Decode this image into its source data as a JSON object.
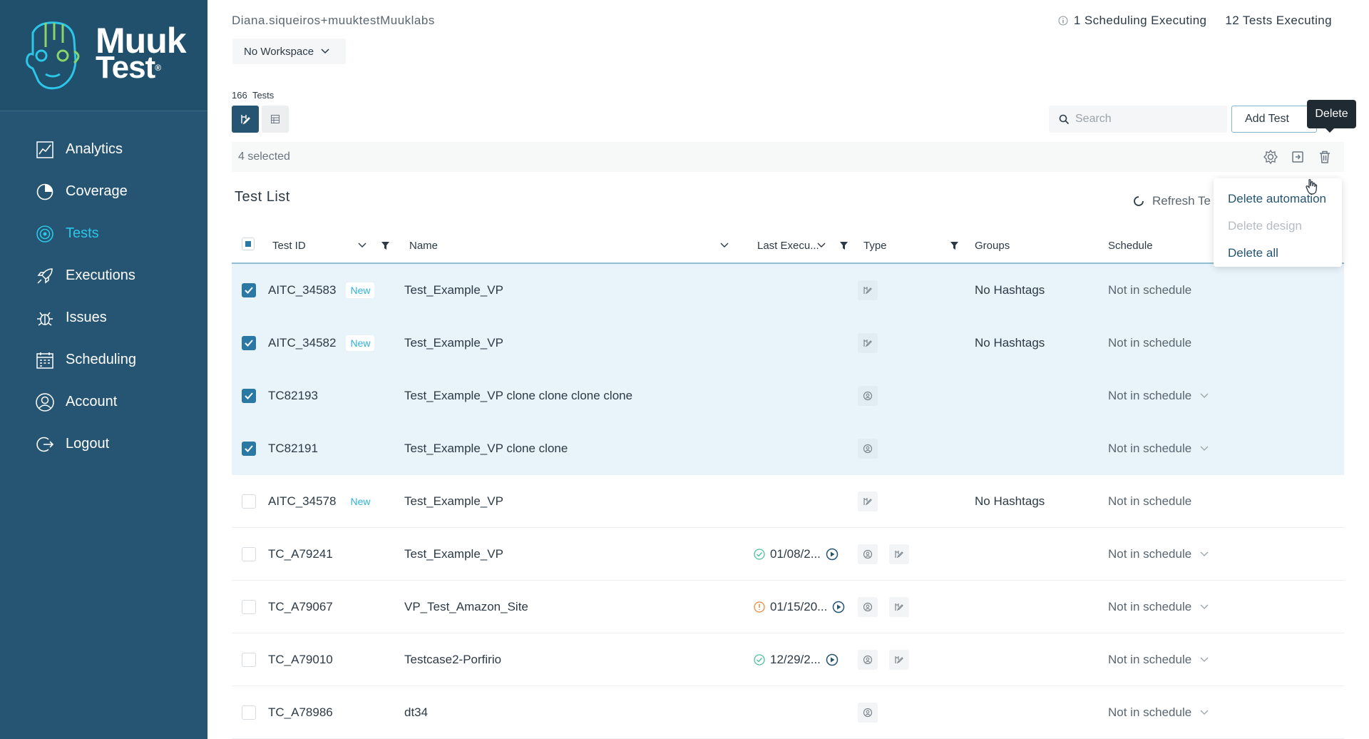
{
  "brand": {
    "line1": "Muuk",
    "line2": "Test",
    "reg": "®"
  },
  "sidebar": {
    "items": [
      {
        "label": "Analytics",
        "icon": "analytics-icon",
        "active": false
      },
      {
        "label": "Coverage",
        "icon": "coverage-icon",
        "active": false
      },
      {
        "label": "Tests",
        "icon": "tests-icon",
        "active": true
      },
      {
        "label": "Executions",
        "icon": "rocket-icon",
        "active": false
      },
      {
        "label": "Issues",
        "icon": "bug-icon",
        "active": false
      },
      {
        "label": "Scheduling",
        "icon": "calendar-icon",
        "active": false
      },
      {
        "label": "Account",
        "icon": "user-icon",
        "active": false
      },
      {
        "label": "Logout",
        "icon": "logout-icon",
        "active": false
      }
    ]
  },
  "header": {
    "user": "Diana.siqueiros+muuktestMuuklabs",
    "workspace": "No Workspace",
    "scheduling_executing": "1 Scheduling Executing",
    "tests_executing": "12 Tests Executing"
  },
  "toolbar": {
    "count": "166",
    "count_label": "Tests",
    "search_placeholder": "Search",
    "add_test": "Add Test",
    "tooltip": "Delete"
  },
  "selection": {
    "text": "4 selected"
  },
  "list": {
    "title": "Test List",
    "refresh": "Refresh Te",
    "columns": {
      "test_id": "Test ID",
      "name": "Name",
      "last_exec": "Last Execu...",
      "type": "Type",
      "groups": "Groups",
      "schedule": "Schedule"
    },
    "rows": [
      {
        "checked": true,
        "id": "AITC_34583",
        "badge": "New",
        "name": "Test_Example_VP",
        "last": "",
        "status": "",
        "types": [
          "design"
        ],
        "groups": "No Hashtags",
        "schedule": "Not in schedule",
        "dropdown": false
      },
      {
        "checked": true,
        "id": "AITC_34582",
        "badge": "New",
        "name": "Test_Example_VP",
        "last": "",
        "status": "",
        "types": [
          "design"
        ],
        "groups": "No Hashtags",
        "schedule": "Not in schedule",
        "dropdown": false
      },
      {
        "checked": true,
        "id": "TC82193",
        "badge": "",
        "name": "Test_Example_VP clone clone clone clone",
        "last": "",
        "status": "",
        "types": [
          "auto"
        ],
        "groups": "",
        "schedule": "Not in schedule",
        "dropdown": true
      },
      {
        "checked": true,
        "id": "TC82191",
        "badge": "",
        "name": "Test_Example_VP clone clone",
        "last": "",
        "status": "",
        "types": [
          "auto"
        ],
        "groups": "",
        "schedule": "Not in schedule",
        "dropdown": true
      },
      {
        "checked": false,
        "id": "AITC_34578",
        "badge": "New",
        "name": "Test_Example_VP",
        "last": "",
        "status": "",
        "types": [
          "design"
        ],
        "groups": "No Hashtags",
        "schedule": "Not in schedule",
        "dropdown": false
      },
      {
        "checked": false,
        "id": "TC_A79241",
        "badge": "",
        "name": "Test_Example_VP",
        "last": "01/08/2...",
        "status": "ok",
        "types": [
          "auto",
          "design"
        ],
        "groups": "",
        "schedule": "Not in schedule",
        "dropdown": true
      },
      {
        "checked": false,
        "id": "TC_A79067",
        "badge": "",
        "name": "VP_Test_Amazon_Site",
        "last": "01/15/20...",
        "status": "warn",
        "types": [
          "auto",
          "design"
        ],
        "groups": "",
        "schedule": "Not in schedule",
        "dropdown": true
      },
      {
        "checked": false,
        "id": "TC_A79010",
        "badge": "",
        "name": "Testcase2-Porfirio",
        "last": "12/29/2...",
        "status": "ok",
        "types": [
          "auto",
          "design"
        ],
        "groups": "",
        "schedule": "Not in schedule",
        "dropdown": true
      },
      {
        "checked": false,
        "id": "TC_A78986",
        "badge": "",
        "name": "dt34",
        "last": "",
        "status": "",
        "types": [
          "auto"
        ],
        "groups": "",
        "schedule": "Not in schedule",
        "dropdown": true
      }
    ]
  },
  "menu": {
    "items": [
      {
        "label": "Delete automation",
        "disabled": false
      },
      {
        "label": "Delete design",
        "disabled": true
      },
      {
        "label": "Delete all",
        "disabled": false
      }
    ]
  },
  "colors": {
    "sidebar": "#255572",
    "accent": "#2cc6e8",
    "selected_row": "#e8f3fa",
    "checkbox": "#2a79a5"
  }
}
